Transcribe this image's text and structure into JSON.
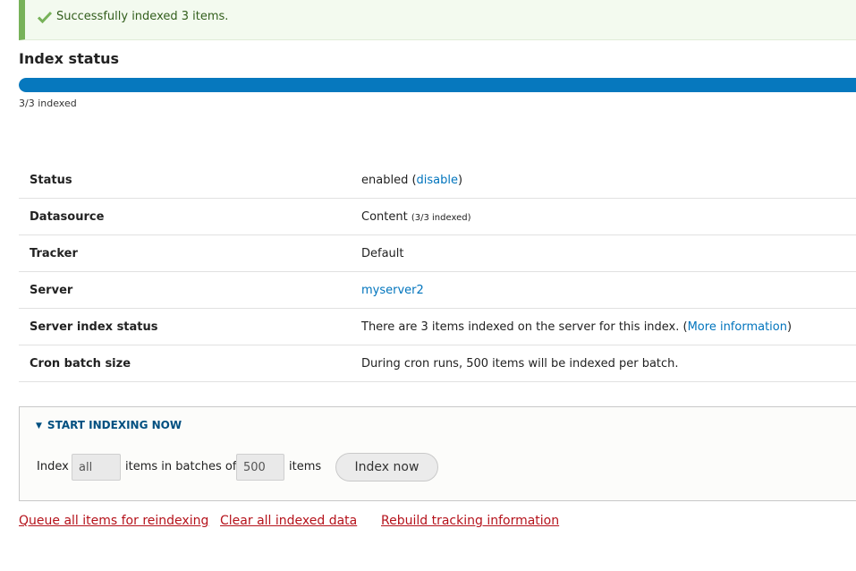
{
  "message": {
    "text": "Successfully indexed 3 items.",
    "color": "#77b259"
  },
  "index_status": {
    "heading": "Index status",
    "progress_fraction": 1.0,
    "progress_label": "3/3 indexed"
  },
  "info": {
    "status": {
      "label": "Status",
      "value_prefix": "enabled (",
      "link": "disable",
      "value_suffix": ")"
    },
    "datasource": {
      "label": "Datasource",
      "value": "Content",
      "detail": "(3/3 indexed)"
    },
    "tracker": {
      "label": "Tracker",
      "value": "Default"
    },
    "server": {
      "label": "Server",
      "link": "myserver2"
    },
    "server_index_status": {
      "label": "Server index status",
      "value": "There are 3 items indexed on the server for this index. (",
      "link": "More information",
      "value_suffix": ")"
    },
    "cron": {
      "label": "Cron batch size",
      "value": "During cron runs, 500 items will be indexed per batch."
    }
  },
  "indexing": {
    "summary": "Start indexing now",
    "label_index": "Index",
    "limit_value": "all",
    "label_batches": "items in batches of",
    "batch_value": "500",
    "label_items": "items",
    "button": "Index now"
  },
  "actions": {
    "queue": "Queue all items for reindexing",
    "clear": "Clear all indexed data",
    "rebuild": "Rebuild tracking information"
  },
  "colors": {
    "accent": "#0678be",
    "link": "#0074bd",
    "danger_link": "#b5121b"
  }
}
